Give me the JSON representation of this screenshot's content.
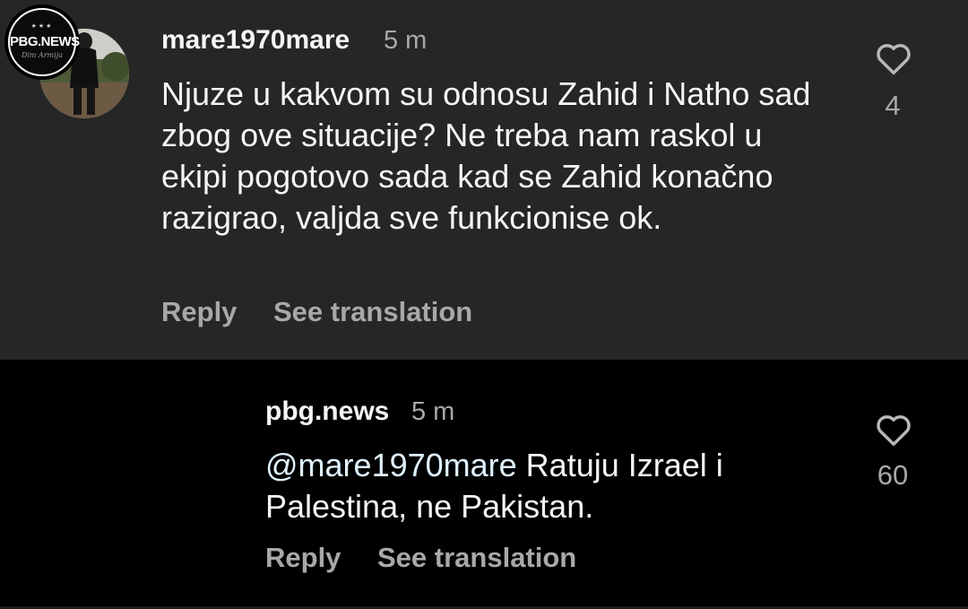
{
  "comments": [
    {
      "username": "mare1970mare",
      "time": "5 m",
      "text": "Njuze u kakvom su odnosu Zahid i Natho sad zbog ove situacije? Ne treba nam raskol u ekipi pogotovo sada kad se Zahid konačno razigrao, valjda sve funkcionise ok.",
      "reply_label": "Reply",
      "translate_label": "See translation",
      "likes": "4",
      "like_icon": "heart-outline-icon"
    },
    {
      "username": "pbg.news",
      "time": "5 m",
      "mention": "@mare1970mare",
      "text": " Ratuju Izrael i Palestina, ne Pakistan.",
      "reply_label": "Reply",
      "translate_label": "See translation",
      "likes": "60",
      "like_icon": "heart-outline-icon",
      "avatar_logo": "PBG.NEWS"
    }
  ],
  "colors": {
    "background_top": "#262626",
    "background_bottom": "#000000",
    "text_primary": "#f5f5f5",
    "text_secondary": "#a8a8a8",
    "mention": "#e0f1ff"
  }
}
